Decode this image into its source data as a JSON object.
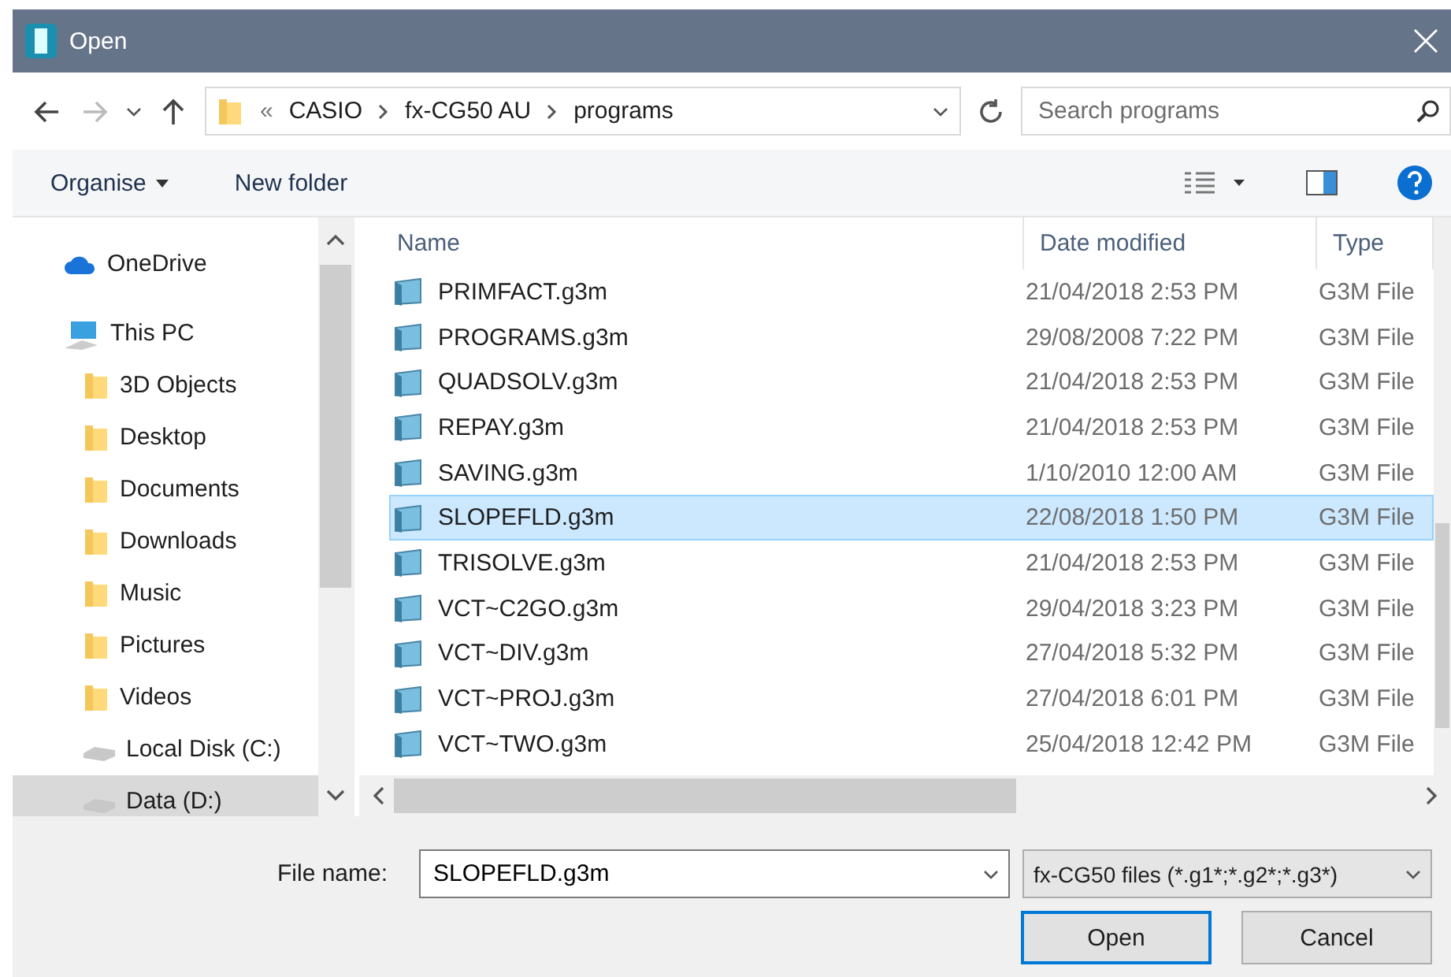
{
  "window": {
    "title": "Open"
  },
  "address": {
    "overflow": "«",
    "segments": [
      "CASIO",
      "fx-CG50 AU",
      "programs"
    ]
  },
  "search": {
    "placeholder": "Search programs"
  },
  "toolbar": {
    "organise": "Organise",
    "new_folder": "New folder"
  },
  "nav": [
    {
      "label": "OneDrive",
      "kind": "cloud",
      "selected": false
    },
    {
      "label": "This PC",
      "kind": "pc",
      "selected": false,
      "children": [
        {
          "label": "3D Objects",
          "kind": "folder",
          "selected": false
        },
        {
          "label": "Desktop",
          "kind": "folder",
          "selected": false
        },
        {
          "label": "Documents",
          "kind": "folder",
          "selected": false
        },
        {
          "label": "Downloads",
          "kind": "folder",
          "selected": false
        },
        {
          "label": "Music",
          "kind": "folder",
          "selected": false
        },
        {
          "label": "Pictures",
          "kind": "folder",
          "selected": false
        },
        {
          "label": "Videos",
          "kind": "folder",
          "selected": false
        },
        {
          "label": "Local Disk (C:)",
          "kind": "drive",
          "selected": false
        },
        {
          "label": "Data (D:)",
          "kind": "drive",
          "selected": true
        }
      ]
    }
  ],
  "table": {
    "columns": [
      "Name",
      "Date modified",
      "Type"
    ],
    "rows": [
      {
        "name": "PRIMFACT.g3m",
        "date": "21/04/2018 2:53 PM",
        "type": "G3M File",
        "selected": false
      },
      {
        "name": "PROGRAMS.g3m",
        "date": "29/08/2008 7:22 PM",
        "type": "G3M File",
        "selected": false
      },
      {
        "name": "QUADSOLV.g3m",
        "date": "21/04/2018 2:53 PM",
        "type": "G3M File",
        "selected": false
      },
      {
        "name": "REPAY.g3m",
        "date": "21/04/2018 2:53 PM",
        "type": "G3M File",
        "selected": false
      },
      {
        "name": "SAVING.g3m",
        "date": "1/10/2010 12:00 AM",
        "type": "G3M File",
        "selected": false
      },
      {
        "name": "SLOPEFLD.g3m",
        "date": "22/08/2018 1:50 PM",
        "type": "G3M File",
        "selected": true
      },
      {
        "name": "TRISOLVE.g3m",
        "date": "21/04/2018 2:53 PM",
        "type": "G3M File",
        "selected": false
      },
      {
        "name": "VCT~C2GO.g3m",
        "date": "29/04/2018 3:23 PM",
        "type": "G3M File",
        "selected": false
      },
      {
        "name": "VCT~DIV.g3m",
        "date": "27/04/2018 5:32 PM",
        "type": "G3M File",
        "selected": false
      },
      {
        "name": "VCT~PROJ.g3m",
        "date": "27/04/2018 6:01 PM",
        "type": "G3M File",
        "selected": false
      },
      {
        "name": "VCT~TWO.g3m",
        "date": "25/04/2018 12:42 PM",
        "type": "G3M File",
        "selected": false
      }
    ]
  },
  "footer": {
    "file_name_label": "File name:",
    "file_name": "SLOPEFLD.g3m",
    "filter": "fx-CG50 files (*.g1*;*.g2*;*.g3*)",
    "buttons": [
      {
        "label": "Open",
        "kind": "default"
      },
      {
        "label": "Cancel",
        "kind": "normal"
      }
    ]
  }
}
